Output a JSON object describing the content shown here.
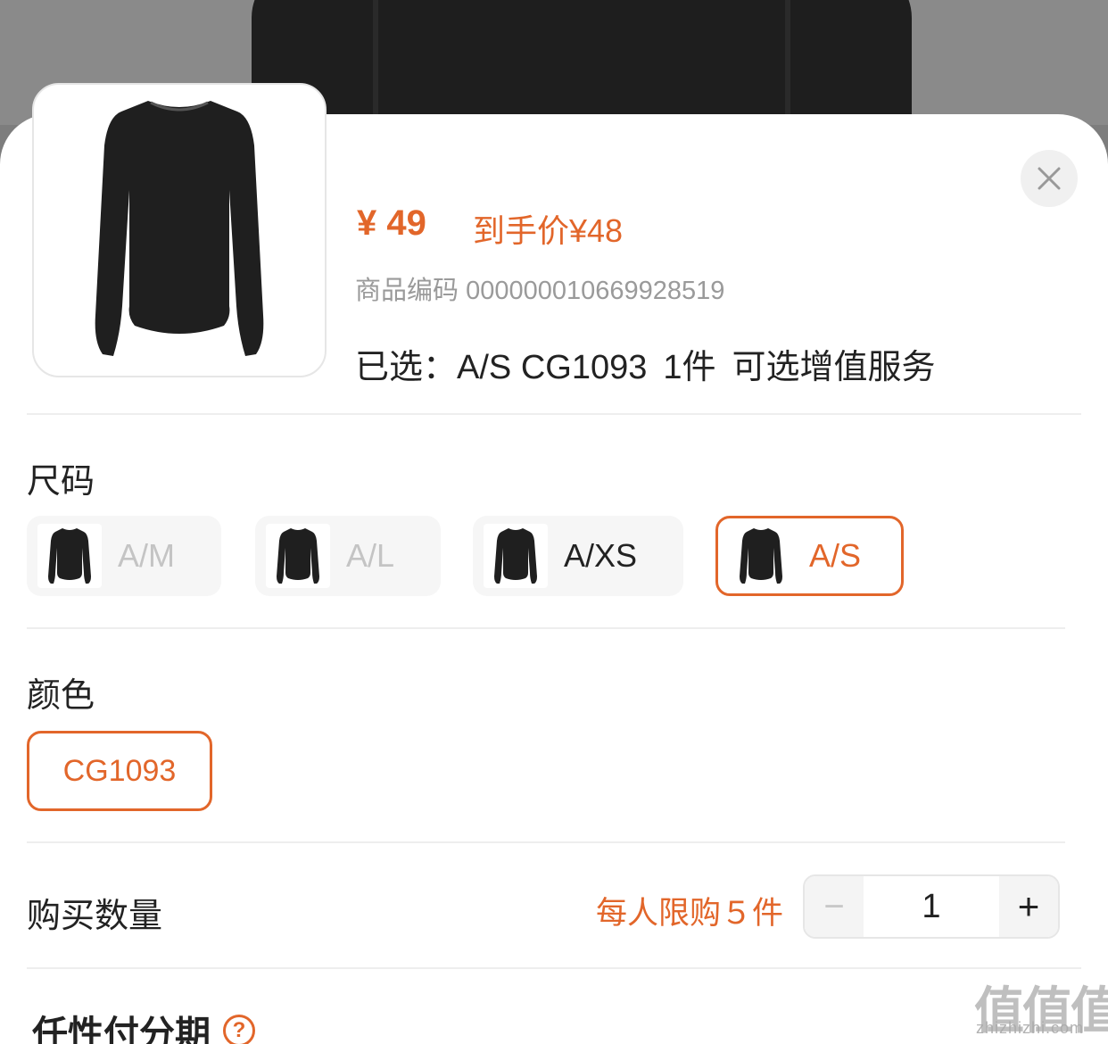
{
  "product": {
    "price": "¥ 49",
    "hand_price": "到手价¥48",
    "sku_label": "商品编码",
    "sku_value": "000000010669928519",
    "selected_prefix": "已选：",
    "selected_size_color": "A/S CG1093",
    "selected_qty": "1件",
    "selected_service": "可选增值服务"
  },
  "size": {
    "title": "尺码",
    "options": [
      {
        "label": "A/M",
        "state": "unavailable"
      },
      {
        "label": "A/L",
        "state": "unavailable"
      },
      {
        "label": "A/XS",
        "state": "available"
      },
      {
        "label": "A/S",
        "state": "selected"
      }
    ]
  },
  "color": {
    "title": "颜色",
    "options": [
      {
        "label": "CG1093",
        "state": "selected"
      }
    ]
  },
  "quantity": {
    "title": "购买数量",
    "limit": "每人限购５件",
    "value": "1",
    "minus": "−",
    "plus": "+"
  },
  "installment": {
    "title": "任性付分期",
    "help_icon": "?"
  },
  "watermark": {
    "main": "值值值",
    "sub": "zhizhizhi.com"
  },
  "colors": {
    "accent": "#e2662a",
    "text": "#222222",
    "muted": "#9a9a9a"
  }
}
